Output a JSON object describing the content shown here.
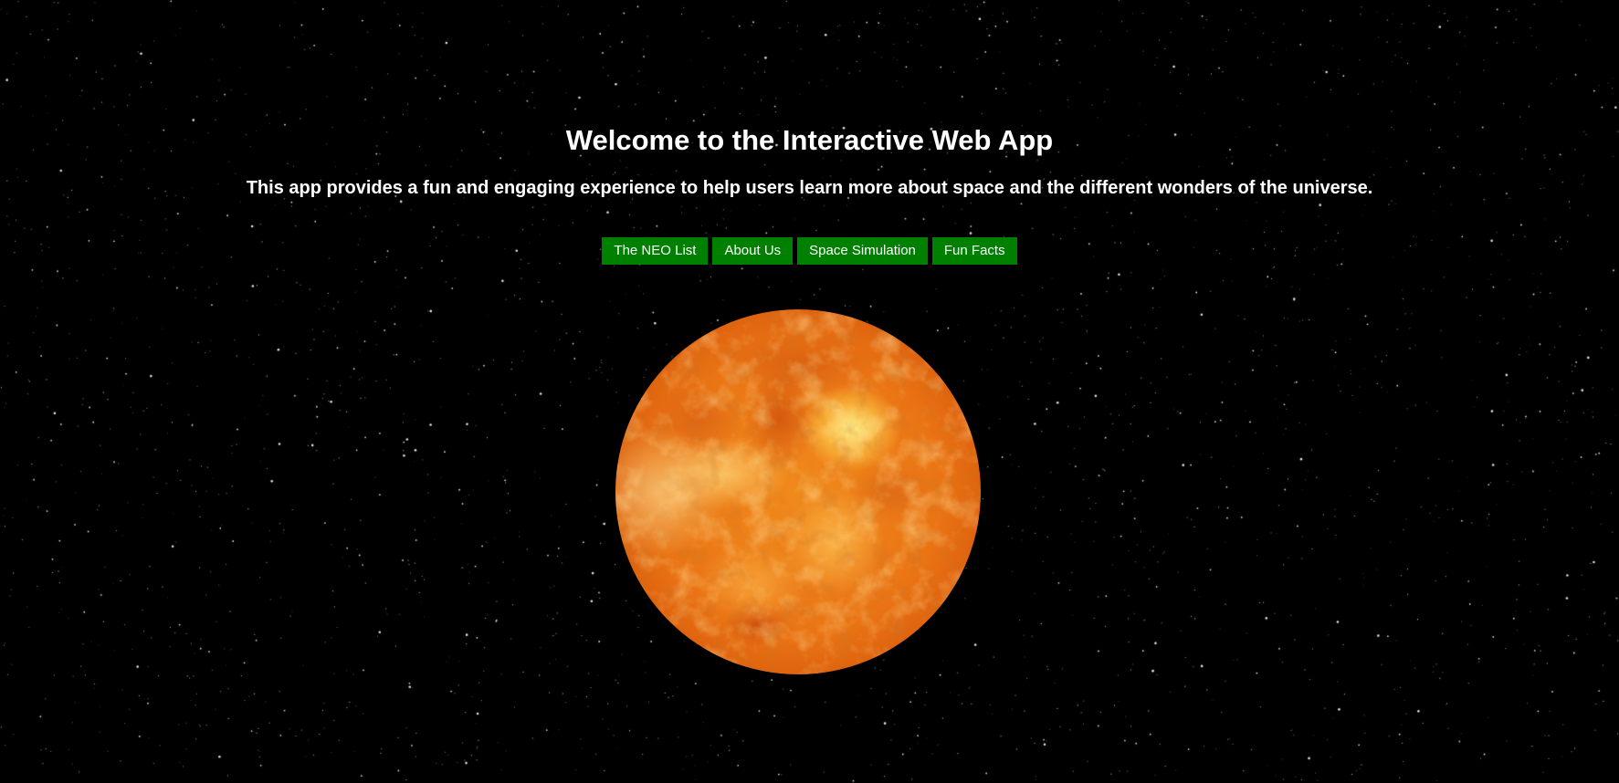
{
  "header": {
    "title": "Welcome to the Interactive Web App",
    "subtitle": "This app provides a fun and engaging experience to help users learn more about space and the different wonders of the universe."
  },
  "nav": {
    "buttons": [
      {
        "label": "The NEO List"
      },
      {
        "label": "About Us"
      },
      {
        "label": "Space Simulation"
      },
      {
        "label": "Fun Facts"
      }
    ]
  },
  "colors": {
    "background": "#000000",
    "button_bg": "#008000",
    "text": "#ffffff",
    "sun_core": "#ea7414"
  }
}
